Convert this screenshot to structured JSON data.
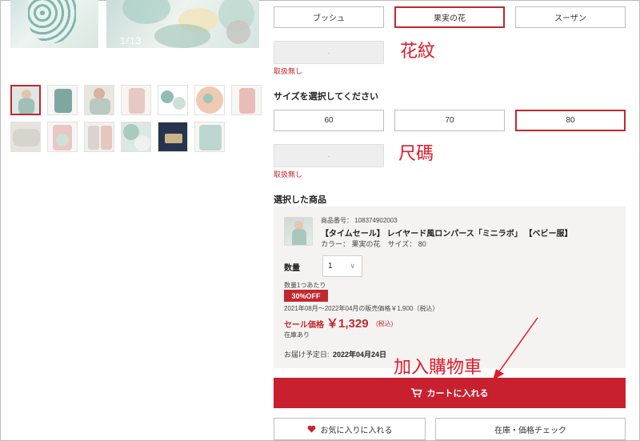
{
  "gallery": {
    "counter": "1/13"
  },
  "color_options": [
    "ブッシュ",
    "果実の花",
    "スーザン"
  ],
  "color_selected_index": 1,
  "color_status": "取扱無し",
  "annotations": {
    "pattern": "花紋",
    "size": "尺碼",
    "add_to_cart": "加入購物車"
  },
  "size_section": {
    "title": "サイズを選択してください",
    "options": [
      "60",
      "70",
      "80"
    ],
    "selected_index": 2,
    "status": "取扱無し"
  },
  "selected_product": {
    "title": "選択した商品",
    "product_number": "商品番号： 108374902003",
    "name": "【タイムセール】 レイヤード風ロンパース「ミニラボ」 【ベビー服】",
    "color_size": "カラー： 果実の花　サイズ： 80",
    "quantity_label": "数量",
    "quantity_value": "1",
    "per_unit": "数量1つあたり",
    "discount_badge": "30%OFF",
    "regular_price": "2021年08月～2022年04月の販売価格￥1,900（税込）",
    "sale_label": "セール価格",
    "sale_price": "￥1,329",
    "tax_note": "(税込)",
    "stock": "在庫あり",
    "delivery_label": "お届け予定日:",
    "delivery_date": "2022年04月24日"
  },
  "buttons": {
    "add_to_cart": "カートに入れる",
    "favorite": "お気に入りに入れる",
    "stock_check": "在庫・価格チェック"
  },
  "colors": {
    "accent": "#c0282f",
    "annotation": "#e3192a",
    "panel_bg": "#f4f3f1"
  }
}
